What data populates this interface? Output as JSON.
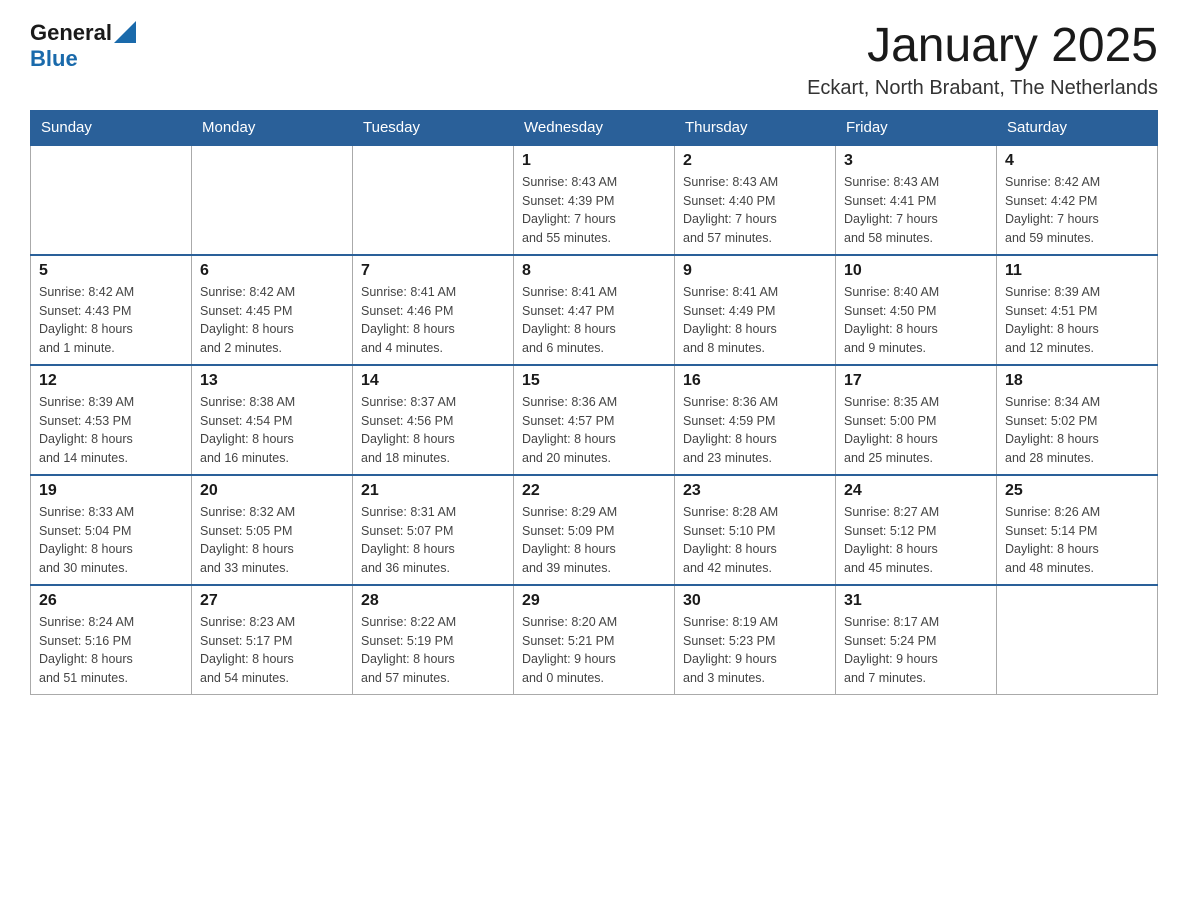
{
  "header": {
    "logo_general": "General",
    "logo_blue": "Blue",
    "title": "January 2025",
    "subtitle": "Eckart, North Brabant, The Netherlands"
  },
  "days_of_week": [
    "Sunday",
    "Monday",
    "Tuesday",
    "Wednesday",
    "Thursday",
    "Friday",
    "Saturday"
  ],
  "weeks": [
    [
      {
        "day": "",
        "info": ""
      },
      {
        "day": "",
        "info": ""
      },
      {
        "day": "",
        "info": ""
      },
      {
        "day": "1",
        "info": "Sunrise: 8:43 AM\nSunset: 4:39 PM\nDaylight: 7 hours\nand 55 minutes."
      },
      {
        "day": "2",
        "info": "Sunrise: 8:43 AM\nSunset: 4:40 PM\nDaylight: 7 hours\nand 57 minutes."
      },
      {
        "day": "3",
        "info": "Sunrise: 8:43 AM\nSunset: 4:41 PM\nDaylight: 7 hours\nand 58 minutes."
      },
      {
        "day": "4",
        "info": "Sunrise: 8:42 AM\nSunset: 4:42 PM\nDaylight: 7 hours\nand 59 minutes."
      }
    ],
    [
      {
        "day": "5",
        "info": "Sunrise: 8:42 AM\nSunset: 4:43 PM\nDaylight: 8 hours\nand 1 minute."
      },
      {
        "day": "6",
        "info": "Sunrise: 8:42 AM\nSunset: 4:45 PM\nDaylight: 8 hours\nand 2 minutes."
      },
      {
        "day": "7",
        "info": "Sunrise: 8:41 AM\nSunset: 4:46 PM\nDaylight: 8 hours\nand 4 minutes."
      },
      {
        "day": "8",
        "info": "Sunrise: 8:41 AM\nSunset: 4:47 PM\nDaylight: 8 hours\nand 6 minutes."
      },
      {
        "day": "9",
        "info": "Sunrise: 8:41 AM\nSunset: 4:49 PM\nDaylight: 8 hours\nand 8 minutes."
      },
      {
        "day": "10",
        "info": "Sunrise: 8:40 AM\nSunset: 4:50 PM\nDaylight: 8 hours\nand 9 minutes."
      },
      {
        "day": "11",
        "info": "Sunrise: 8:39 AM\nSunset: 4:51 PM\nDaylight: 8 hours\nand 12 minutes."
      }
    ],
    [
      {
        "day": "12",
        "info": "Sunrise: 8:39 AM\nSunset: 4:53 PM\nDaylight: 8 hours\nand 14 minutes."
      },
      {
        "day": "13",
        "info": "Sunrise: 8:38 AM\nSunset: 4:54 PM\nDaylight: 8 hours\nand 16 minutes."
      },
      {
        "day": "14",
        "info": "Sunrise: 8:37 AM\nSunset: 4:56 PM\nDaylight: 8 hours\nand 18 minutes."
      },
      {
        "day": "15",
        "info": "Sunrise: 8:36 AM\nSunset: 4:57 PM\nDaylight: 8 hours\nand 20 minutes."
      },
      {
        "day": "16",
        "info": "Sunrise: 8:36 AM\nSunset: 4:59 PM\nDaylight: 8 hours\nand 23 minutes."
      },
      {
        "day": "17",
        "info": "Sunrise: 8:35 AM\nSunset: 5:00 PM\nDaylight: 8 hours\nand 25 minutes."
      },
      {
        "day": "18",
        "info": "Sunrise: 8:34 AM\nSunset: 5:02 PM\nDaylight: 8 hours\nand 28 minutes."
      }
    ],
    [
      {
        "day": "19",
        "info": "Sunrise: 8:33 AM\nSunset: 5:04 PM\nDaylight: 8 hours\nand 30 minutes."
      },
      {
        "day": "20",
        "info": "Sunrise: 8:32 AM\nSunset: 5:05 PM\nDaylight: 8 hours\nand 33 minutes."
      },
      {
        "day": "21",
        "info": "Sunrise: 8:31 AM\nSunset: 5:07 PM\nDaylight: 8 hours\nand 36 minutes."
      },
      {
        "day": "22",
        "info": "Sunrise: 8:29 AM\nSunset: 5:09 PM\nDaylight: 8 hours\nand 39 minutes."
      },
      {
        "day": "23",
        "info": "Sunrise: 8:28 AM\nSunset: 5:10 PM\nDaylight: 8 hours\nand 42 minutes."
      },
      {
        "day": "24",
        "info": "Sunrise: 8:27 AM\nSunset: 5:12 PM\nDaylight: 8 hours\nand 45 minutes."
      },
      {
        "day": "25",
        "info": "Sunrise: 8:26 AM\nSunset: 5:14 PM\nDaylight: 8 hours\nand 48 minutes."
      }
    ],
    [
      {
        "day": "26",
        "info": "Sunrise: 8:24 AM\nSunset: 5:16 PM\nDaylight: 8 hours\nand 51 minutes."
      },
      {
        "day": "27",
        "info": "Sunrise: 8:23 AM\nSunset: 5:17 PM\nDaylight: 8 hours\nand 54 minutes."
      },
      {
        "day": "28",
        "info": "Sunrise: 8:22 AM\nSunset: 5:19 PM\nDaylight: 8 hours\nand 57 minutes."
      },
      {
        "day": "29",
        "info": "Sunrise: 8:20 AM\nSunset: 5:21 PM\nDaylight: 9 hours\nand 0 minutes."
      },
      {
        "day": "30",
        "info": "Sunrise: 8:19 AM\nSunset: 5:23 PM\nDaylight: 9 hours\nand 3 minutes."
      },
      {
        "day": "31",
        "info": "Sunrise: 8:17 AM\nSunset: 5:24 PM\nDaylight: 9 hours\nand 7 minutes."
      },
      {
        "day": "",
        "info": ""
      }
    ]
  ]
}
